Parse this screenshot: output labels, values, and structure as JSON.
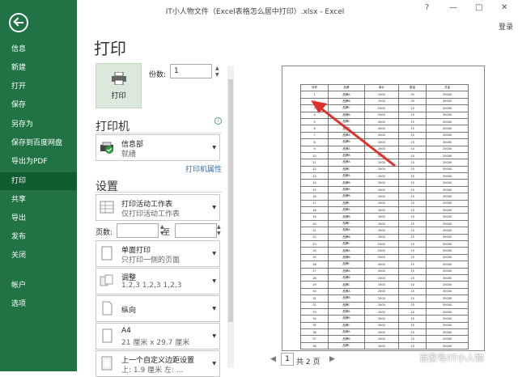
{
  "window": {
    "title": "IT小人物文件（Excel表格怎么居中打印）.xlsx - Excel",
    "help": "?",
    "minimize": "—",
    "restore": "□",
    "close": "✕",
    "login": "登录"
  },
  "sidebar": {
    "items": [
      {
        "label": "信息"
      },
      {
        "label": "新建"
      },
      {
        "label": "打开"
      },
      {
        "label": "保存"
      },
      {
        "label": "另存为"
      },
      {
        "label": "保存到百度网盘"
      },
      {
        "label": "导出为PDF"
      },
      {
        "label": "打印"
      },
      {
        "label": "共享"
      },
      {
        "label": "导出"
      },
      {
        "label": "发布"
      },
      {
        "label": "关闭"
      },
      {
        "label": "帐户"
      },
      {
        "label": "选项"
      }
    ]
  },
  "print": {
    "heading": "打印",
    "button_label": "打印",
    "copies_label": "份数:",
    "copies_value": "1"
  },
  "printer": {
    "heading": "打印机",
    "name": "信息部",
    "status": "就绪",
    "properties_link": "打印机属性"
  },
  "settings": {
    "heading": "设置",
    "what": {
      "title": "打印活动工作表",
      "desc": "仅打印活动工作表"
    },
    "pages_label": "页数:",
    "to_label": "至",
    "sides": {
      "title": "单面打印",
      "desc": "只打印一侧的页面"
    },
    "collate": {
      "title": "调整",
      "desc": "1,2,3    1,2,3    1,2,3"
    },
    "orientation": {
      "title": "纵向"
    },
    "paper": {
      "title": "A4",
      "desc": "21 厘米 x 29.7 厘米"
    },
    "margins": {
      "title": "上一个自定义边距设置",
      "desc": "上: 1.9 厘米 左: ..."
    }
  },
  "preview": {
    "current_page": "1",
    "total_pages": "共 2 页",
    "header": [
      "序号",
      "品牌",
      "单价",
      "数量",
      "总金"
    ],
    "rows": [
      [
        "1",
        "品牌A",
        "1000",
        "30",
        "30000"
      ],
      [
        "2",
        "品牌B",
        "1500",
        "30",
        "45000"
      ],
      [
        "3",
        "品牌C",
        "2000",
        "10",
        "20000"
      ],
      [
        "4",
        "品牌B",
        "2000",
        "15",
        "30000"
      ],
      [
        "5",
        "品牌C",
        "2000",
        "15",
        "30000"
      ],
      [
        "6",
        "品牌B",
        "2000",
        "15",
        "30000"
      ],
      [
        "7",
        "品牌A",
        "2000",
        "10",
        "20000"
      ],
      [
        "8",
        "品牌B",
        "2000",
        "15",
        "30000"
      ],
      [
        "9",
        "品牌A",
        "2000",
        "10",
        "20000"
      ],
      [
        "10",
        "品牌B",
        "2000",
        "10",
        "20000"
      ],
      [
        "11",
        "品牌A",
        "2000",
        "10",
        "20000"
      ],
      [
        "12",
        "品牌C",
        "2000",
        "15",
        "30000"
      ],
      [
        "13",
        "品牌A",
        "2000",
        "15",
        "30000"
      ],
      [
        "14",
        "品牌B",
        "2000",
        "10",
        "20000"
      ],
      [
        "15",
        "品牌A",
        "2000",
        "15",
        "30000"
      ],
      [
        "16",
        "品牌B",
        "2000",
        "15",
        "30000"
      ],
      [
        "17",
        "品牌C",
        "2000",
        "10",
        "20000"
      ],
      [
        "18",
        "品牌A",
        "2000",
        "15",
        "30000"
      ],
      [
        "19",
        "品牌B",
        "2000",
        "15",
        "30000"
      ],
      [
        "20",
        "品牌C",
        "2000",
        "15",
        "30000"
      ],
      [
        "21",
        "品牌A",
        "2000",
        "10",
        "20000"
      ],
      [
        "22",
        "品牌B",
        "2000",
        "15",
        "30000"
      ],
      [
        "23",
        "品牌C",
        "2000",
        "15",
        "30000"
      ],
      [
        "24",
        "品牌A",
        "2000",
        "15",
        "30000"
      ],
      [
        "25",
        "品牌B",
        "2000",
        "10",
        "20000"
      ],
      [
        "26",
        "品牌C",
        "2000",
        "15",
        "30000"
      ],
      [
        "27",
        "品牌A",
        "2000",
        "15",
        "30000"
      ],
      [
        "28",
        "品牌B",
        "2000",
        "15",
        "30000"
      ],
      [
        "29",
        "品牌C",
        "2000",
        "10",
        "20000"
      ],
      [
        "30",
        "品牌A",
        "2000",
        "15",
        "30000"
      ],
      [
        "31",
        "品牌B",
        "2000",
        "15",
        "30000"
      ],
      [
        "32",
        "品牌C",
        "2000",
        "15",
        "30000"
      ],
      [
        "33",
        "品牌A",
        "2000",
        "10",
        "20000"
      ],
      [
        "34",
        "品牌B",
        "2000",
        "15",
        "30000"
      ],
      [
        "35",
        "品牌C",
        "2000",
        "15",
        "30000"
      ],
      [
        "36",
        "品牌A",
        "2000",
        "15",
        "30000"
      ],
      [
        "37",
        "品牌B",
        "2000",
        "10",
        "20000"
      ],
      [
        "38",
        "品牌C",
        "2000",
        "15",
        "30000"
      ]
    ]
  },
  "watermark": "百家号/IT小人物",
  "colors": {
    "accent": "#217346",
    "active_nav": "#0e5c2f",
    "arrow": "#e0302a",
    "link": "#2a6ebb"
  }
}
